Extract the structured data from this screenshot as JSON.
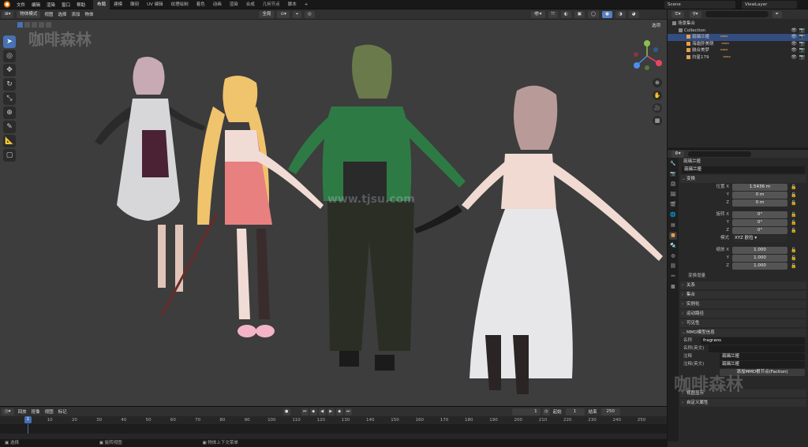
{
  "topbar": {
    "menus": [
      "文件",
      "编辑",
      "渲染",
      "窗口",
      "帮助"
    ],
    "workspaces": [
      "布局",
      "建模",
      "雕刻",
      "UV 编辑",
      "纹理绘制",
      "着色",
      "动画",
      "渲染",
      "合成",
      "几何节点",
      "脚本"
    ],
    "active_workspace": "布局",
    "scene": "Scene",
    "viewlayer": "ViewLayer"
  },
  "viewport_header": {
    "mode": "物体模式",
    "menus": [
      "视图",
      "选择",
      "添加",
      "物体"
    ],
    "orientation": "全局",
    "options_label": "选项"
  },
  "watermark_text": "咖啡森林",
  "viewport_watermark": "www.tjsu.com",
  "outliner": {
    "rows": [
      {
        "label": "场景集合",
        "indent": 0,
        "selected": false
      },
      {
        "label": "Collection",
        "indent": 1,
        "selected": false
      },
      {
        "label": "琉璃兰娅",
        "indent": 2,
        "selected": true
      },
      {
        "label": "海霜肝美萌",
        "indent": 2,
        "selected": false
      },
      {
        "label": "融合美梦",
        "indent": 2,
        "selected": false
      },
      {
        "label": "白星179",
        "indent": 2,
        "selected": false
      }
    ]
  },
  "properties": {
    "object_name": "琉璃兰娅",
    "field_name": "琉璃兰娅",
    "transform_header": "变换",
    "location": {
      "label_x": "位置 X",
      "label_y": "Y",
      "label_z": "Z",
      "x": "1.5436 m",
      "y": "0 m",
      "z": "0 m"
    },
    "rotation": {
      "label_x": "旋转 X",
      "label_y": "Y",
      "label_z": "Z",
      "x": "0°",
      "y": "0°",
      "z": "0°"
    },
    "mode_label": "模式",
    "mode_value": "XYZ 欧拉",
    "scale": {
      "label_x": "缩放 X",
      "label_y": "Y",
      "label_z": "Z",
      "x": "1.000",
      "y": "1.000",
      "z": "1.000"
    },
    "delta_transform": "变换增量",
    "sections": [
      "关系",
      "集合",
      "实例化",
      "运动路径",
      "可见性"
    ],
    "mmd_header": "MMD模型信息",
    "mmd_name_label": "名称",
    "mmd_name_value": "fragrans",
    "mmd_name_en_label": "名称(英文)",
    "mmd_comment_label": "注释",
    "mmd_comment_value": "琉璃兰娅",
    "mmd_comment_en_label": "注释(英文)",
    "mmd_comment_en_value": "琉璃兰娅",
    "mmd_button": "添加MMD根节点(Faction)",
    "bottom_sections": [
      "视图显示",
      "自定义属性"
    ]
  },
  "timeline": {
    "menus": [
      "回放",
      "抠像",
      "视图",
      "标记"
    ],
    "current_frame": "1",
    "start_label": "起始",
    "start": "1",
    "end_label": "结束",
    "end": "250",
    "ruler_ticks": [
      "1",
      "10",
      "20",
      "30",
      "40",
      "50",
      "60",
      "70",
      "80",
      "90",
      "100",
      "110",
      "120",
      "130",
      "140",
      "150",
      "160",
      "170",
      "180",
      "190",
      "200",
      "210",
      "220",
      "230",
      "240",
      "250"
    ]
  },
  "status": {
    "select": "选择",
    "rotate": "旋转视图",
    "context": "物体上下文菜单"
  },
  "colors": {
    "accent": "#4772b3",
    "active_tab": "#e8a04c",
    "viewport_bg": "#3d3d3d"
  }
}
